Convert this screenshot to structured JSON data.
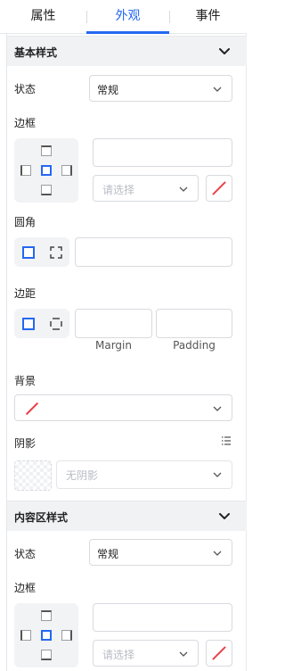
{
  "tabs": [
    {
      "label": "属性",
      "active": false
    },
    {
      "label": "外观",
      "active": true
    },
    {
      "label": "事件",
      "active": false
    }
  ],
  "accent_color": "#2468f2",
  "section_basic": {
    "title": "基本样式",
    "state_label": "状态",
    "state_value": "常规",
    "border_label": "边框",
    "border_style_placeholder": "请选择",
    "radius_label": "圆角",
    "spacing_label": "边距",
    "margin_caption": "Margin",
    "padding_caption": "Padding",
    "background_label": "背景",
    "shadow_label": "阴影",
    "shadow_placeholder": "无阴影"
  },
  "section_content": {
    "title": "内容区样式",
    "state_label": "状态",
    "state_value": "常规",
    "border_label": "边框",
    "border_style_placeholder": "请选择"
  }
}
